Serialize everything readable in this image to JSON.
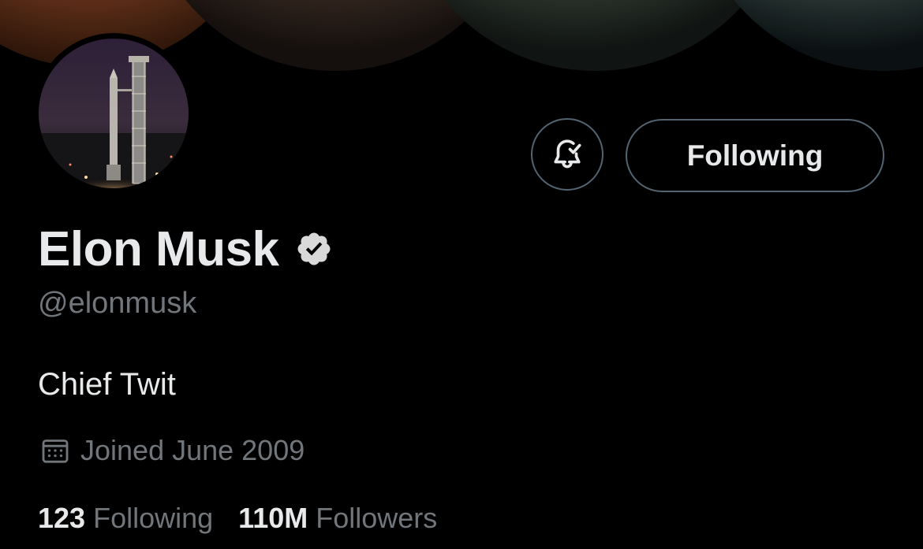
{
  "profile": {
    "display_name": "Elon Musk",
    "handle": "@elonmusk",
    "bio": "Chief Twit",
    "joined": "Joined June 2009",
    "verified": true
  },
  "actions": {
    "notify_icon": "bell-check-icon",
    "following_label": "Following"
  },
  "stats": {
    "following_count": "123",
    "following_label": "Following",
    "followers_count": "110M",
    "followers_label": "Followers"
  },
  "colors": {
    "background": "#000000",
    "primary_text": "#e7e9ea",
    "secondary_text": "#71767b",
    "border": "#536471"
  }
}
